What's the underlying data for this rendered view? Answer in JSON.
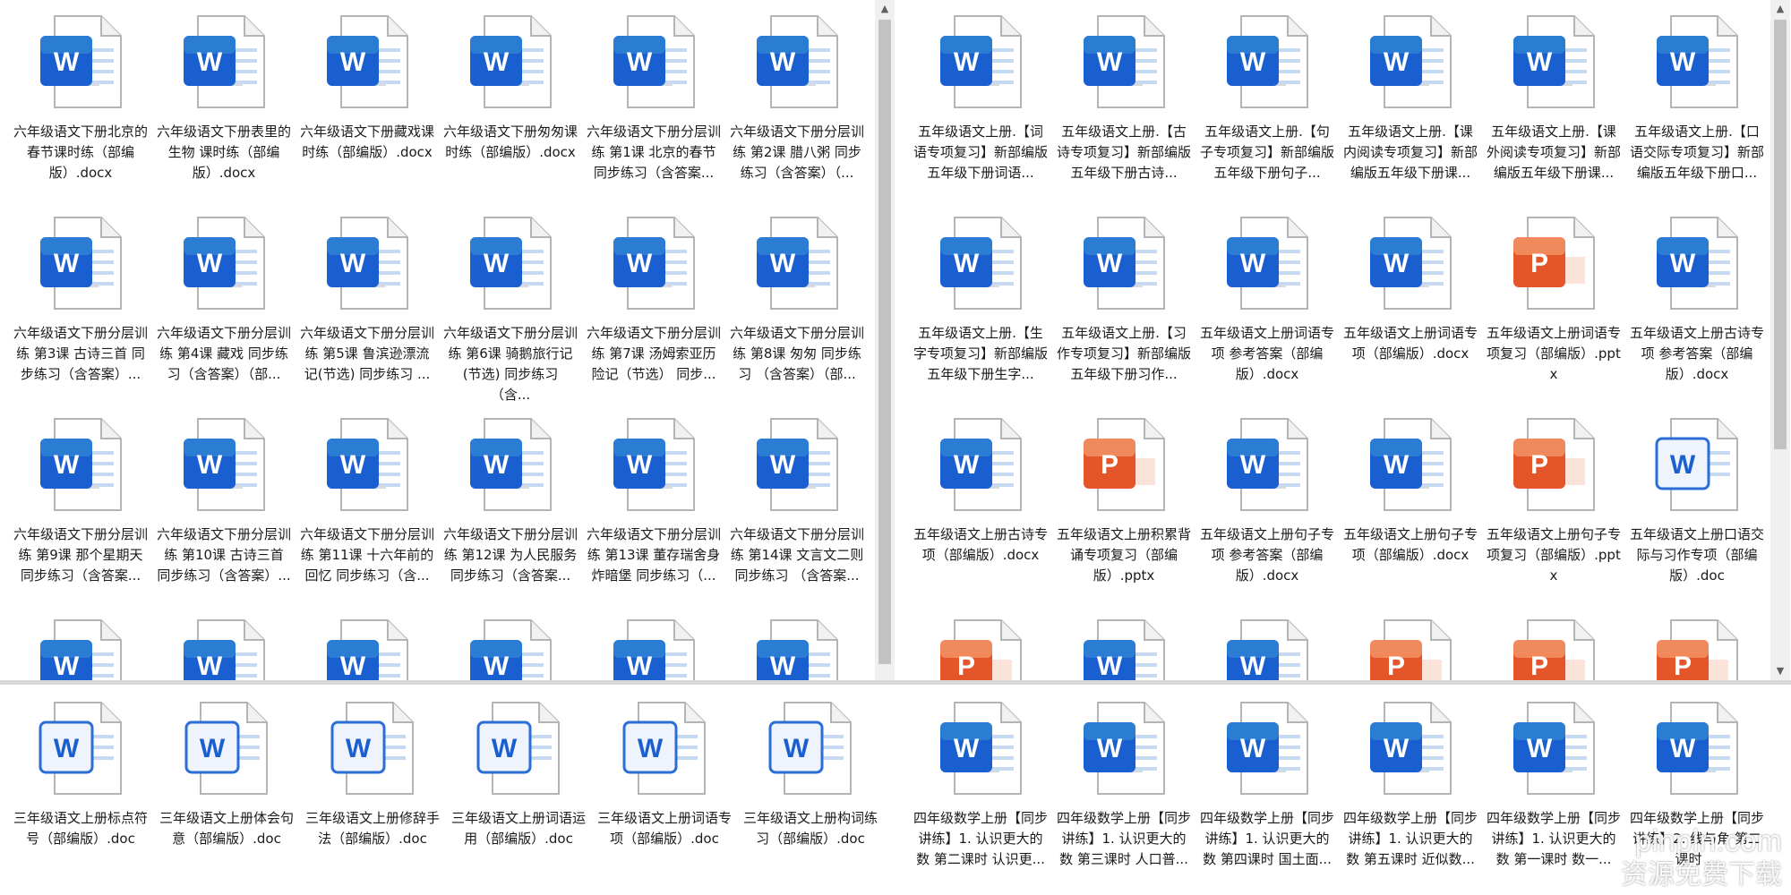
{
  "colors": {
    "word_blue": "#1a5fd0",
    "word_light": "#2b7cd3",
    "ppt_orange": "#e4562a",
    "ppt_light": "#f08a5d"
  },
  "panes": {
    "top_left": {
      "items": [
        {
          "name": "六年级语文下册北京的春节课时练（部编版）.docx",
          "type": "word"
        },
        {
          "name": "六年级语文下册表里的生物 课时练（部编版）.docx",
          "type": "word"
        },
        {
          "name": "六年级语文下册藏戏课时练（部编版）.docx",
          "type": "word"
        },
        {
          "name": "六年级语文下册匆匆课时练（部编版）.docx",
          "type": "word"
        },
        {
          "name": "六年级语文下册分层训练 第1课 北京的春节 同步练习（含答案...",
          "type": "word"
        },
        {
          "name": "六年级语文下册分层训练 第2课 腊八粥 同步练习（含答案）（...",
          "type": "word"
        },
        {
          "name": "六年级语文下册分层训练 第3课 古诗三首 同步练习（含答案）...",
          "type": "word"
        },
        {
          "name": "六年级语文下册分层训练 第4课 藏戏 同步练习（含答案）（部...",
          "type": "word"
        },
        {
          "name": "六年级语文下册分层训练 第5课 鲁滨逊漂流记(节选) 同步练习 ...",
          "type": "word"
        },
        {
          "name": "六年级语文下册分层训练 第6课 骑鹅旅行记(节选) 同步练习 （含...",
          "type": "word"
        },
        {
          "name": "六年级语文下册分层训练 第7课 汤姆索亚历险记（节选） 同步...",
          "type": "word"
        },
        {
          "name": "六年级语文下册分层训练 第8课 匆匆 同步练习 （含答案）（部...",
          "type": "word"
        },
        {
          "name": "六年级语文下册分层训练 第9课 那个星期天 同步练习（含答案...",
          "type": "word"
        },
        {
          "name": "六年级语文下册分层训练 第10课 古诗三首 同步练习（含答案）...",
          "type": "word"
        },
        {
          "name": "六年级语文下册分层训练 第11课 十六年前的回忆 同步练习（含...",
          "type": "word"
        },
        {
          "name": "六年级语文下册分层训练 第12课 为人民服务 同步练习（含答案...",
          "type": "word"
        },
        {
          "name": "六年级语文下册分层训练 第13课 董存瑞舍身炸暗堡 同步练习（...",
          "type": "word"
        },
        {
          "name": "六年级语文下册分层训练 第14课 文言文二则 同步练习 （含答案...",
          "type": "word"
        },
        {
          "name": "",
          "type": "word"
        },
        {
          "name": "",
          "type": "word"
        },
        {
          "name": "",
          "type": "word"
        },
        {
          "name": "",
          "type": "word"
        },
        {
          "name": "",
          "type": "word"
        },
        {
          "name": "",
          "type": "word"
        }
      ]
    },
    "top_right": {
      "items": [
        {
          "name": "五年级语文上册.【词语专项复习】新部编版五年级下册词语...",
          "type": "word"
        },
        {
          "name": "五年级语文上册.【古诗专项复习】新部编版五年级下册古诗...",
          "type": "word"
        },
        {
          "name": "五年级语文上册.【句子专项复习】新部编版五年级下册句子...",
          "type": "word"
        },
        {
          "name": "五年级语文上册.【课内阅读专项复习】新部编版五年级下册课...",
          "type": "word"
        },
        {
          "name": "五年级语文上册.【课外阅读专项复习】新部编版五年级下册课...",
          "type": "word"
        },
        {
          "name": "五年级语文上册.【口语交际专项复习】新部编版五年级下册口...",
          "type": "word"
        },
        {
          "name": "五年级语文上册.【生字专项复习】新部编版五年级下册生字...",
          "type": "word"
        },
        {
          "name": "五年级语文上册.【习作专项复习】新部编版五年级下册习作...",
          "type": "word"
        },
        {
          "name": "五年级语文上册词语专项 参考答案（部编版）.docx",
          "type": "word"
        },
        {
          "name": "五年级语文上册词语专项（部编版）.docx",
          "type": "word"
        },
        {
          "name": "五年级语文上册词语专项复习（部编版）.pptx",
          "type": "ppt"
        },
        {
          "name": "五年级语文上册古诗专项 参考答案（部编版）.docx",
          "type": "word"
        },
        {
          "name": "五年级语文上册古诗专项（部编版）.docx",
          "type": "word"
        },
        {
          "name": "五年级语文上册积累背诵专项复习（部编版）.pptx",
          "type": "ppt"
        },
        {
          "name": "五年级语文上册句子专项 参考答案（部编版）.docx",
          "type": "word"
        },
        {
          "name": "五年级语文上册句子专项（部编版）.docx",
          "type": "word"
        },
        {
          "name": "五年级语文上册句子专项复习（部编版）.pptx",
          "type": "ppt"
        },
        {
          "name": "五年级语文上册口语交际与习作专项（部编版）.doc",
          "type": "word-doc"
        },
        {
          "name": "",
          "type": "ppt"
        },
        {
          "name": "",
          "type": "word"
        },
        {
          "name": "",
          "type": "word"
        },
        {
          "name": "",
          "type": "ppt"
        },
        {
          "name": "",
          "type": "ppt"
        },
        {
          "name": "",
          "type": "ppt"
        }
      ]
    },
    "bottom_left": {
      "items": [
        {
          "name": "三年级语文上册标点符号（部编版）.doc",
          "type": "word-doc"
        },
        {
          "name": "三年级语文上册体会句意（部编版）.doc",
          "type": "word-doc"
        },
        {
          "name": "三年级语文上册修辞手法（部编版）.doc",
          "type": "word-doc"
        },
        {
          "name": "三年级语文上册词语运用（部编版）.doc",
          "type": "word-doc"
        },
        {
          "name": "三年级语文上册词语专项（部编版）.doc",
          "type": "word-doc"
        },
        {
          "name": "三年级语文上册构词练习（部编版）.doc",
          "type": "word-doc"
        }
      ]
    },
    "bottom_right": {
      "items": [
        {
          "name": "四年级数学上册【同步讲练】1. 认识更大的数 第二课时 认识更...",
          "type": "word"
        },
        {
          "name": "四年级数学上册【同步讲练】1. 认识更大的数 第三课时 人口普...",
          "type": "word"
        },
        {
          "name": "四年级数学上册【同步讲练】1. 认识更大的数 第四课时 国土面...",
          "type": "word"
        },
        {
          "name": "四年级数学上册【同步讲练】1. 认识更大的数 第五课时 近似数...",
          "type": "word"
        },
        {
          "name": "四年级数学上册【同步讲练】1. 认识更大的数 第一课时 数一...",
          "type": "word"
        },
        {
          "name": "四年级数学上册【同步讲练】2. 线与角 第二课时 ...",
          "type": "word"
        }
      ]
    }
  },
  "watermark": {
    "line1": "pinpin.com",
    "line2": "资源免费下载"
  }
}
